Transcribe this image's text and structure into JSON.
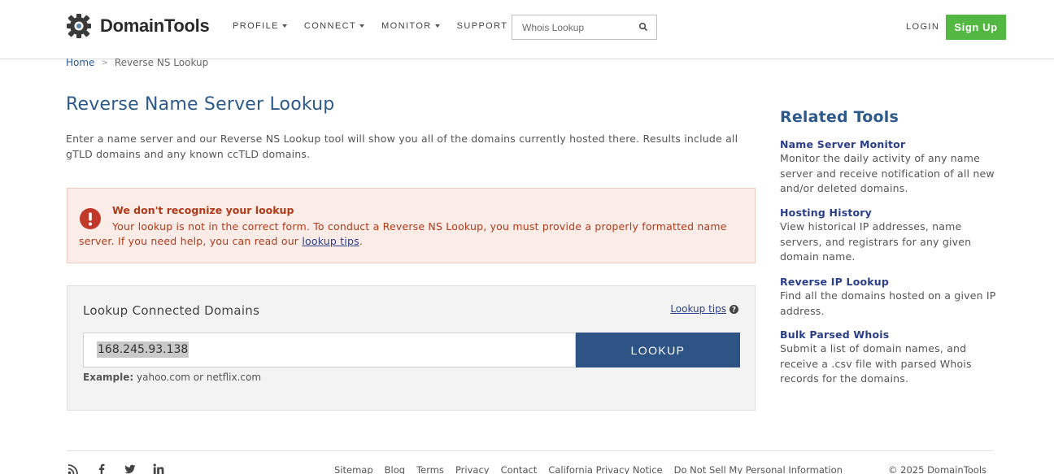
{
  "header": {
    "brand": "DomainTools",
    "nav": [
      {
        "label": "PROFILE",
        "has_menu": true
      },
      {
        "label": "CONNECT",
        "has_menu": true
      },
      {
        "label": "MONITOR",
        "has_menu": true
      },
      {
        "label": "SUPPORT",
        "has_menu": false
      }
    ],
    "search_placeholder": "Whois Lookup",
    "login_label": "LOGIN",
    "signup_label": "Sign Up"
  },
  "breadcrumb": {
    "home": "Home",
    "separator": ">",
    "current": "Reverse NS Lookup"
  },
  "main": {
    "title": "Reverse Name Server Lookup",
    "intro": "Enter a name server and our Reverse NS Lookup tool will show you all of the domains currently hosted there. Results include all gTLD domains and any known ccTLD domains.",
    "alert": {
      "title": "We don't recognize your lookup",
      "body_prefix": "Your lookup is not in the correct form. To conduct a Reverse NS Lookup, you must provide a properly formatted name server. If you need help, you can read our ",
      "body_link": "lookup tips",
      "body_suffix": "."
    },
    "lookup": {
      "title": "Lookup Connected Domains",
      "tips_label": "Lookup tips",
      "input_value": "168.245.93.138",
      "button_label": "LOOKUP",
      "example_label": "Example:",
      "example_text": " yahoo.com or netflix.com"
    }
  },
  "sidebar": {
    "title": "Related Tools",
    "tools": [
      {
        "name": "Name Server Monitor",
        "desc": "Monitor the daily activity of any name server and receive notification of all new and/or deleted domains."
      },
      {
        "name": "Hosting History",
        "desc": "View historical IP addresses, name servers, and registrars for any given domain name."
      },
      {
        "name": "Reverse IP Lookup",
        "desc": "Find all the domains hosted on a given IP address."
      },
      {
        "name": "Bulk Parsed Whois",
        "desc": "Submit a list of domain names, and receive a .csv file with parsed Whois records for the domains."
      }
    ]
  },
  "footer": {
    "social": [
      "rss-icon",
      "facebook-icon",
      "twitter-icon",
      "linkedin-icon"
    ],
    "links": [
      "Sitemap",
      "Blog",
      "Terms",
      "Privacy",
      "Contact",
      "California Privacy Notice",
      "Do Not Sell My Personal Information"
    ],
    "copyright": "© 2025 DomainTools"
  },
  "colors": {
    "brand_blue": "#2d5a8a",
    "link_blue": "#2a3e8a",
    "signup_green": "#52b842",
    "lookup_button": "#2e5486",
    "alert_red": "#b03a1a",
    "alert_bg": "#fbece8"
  }
}
